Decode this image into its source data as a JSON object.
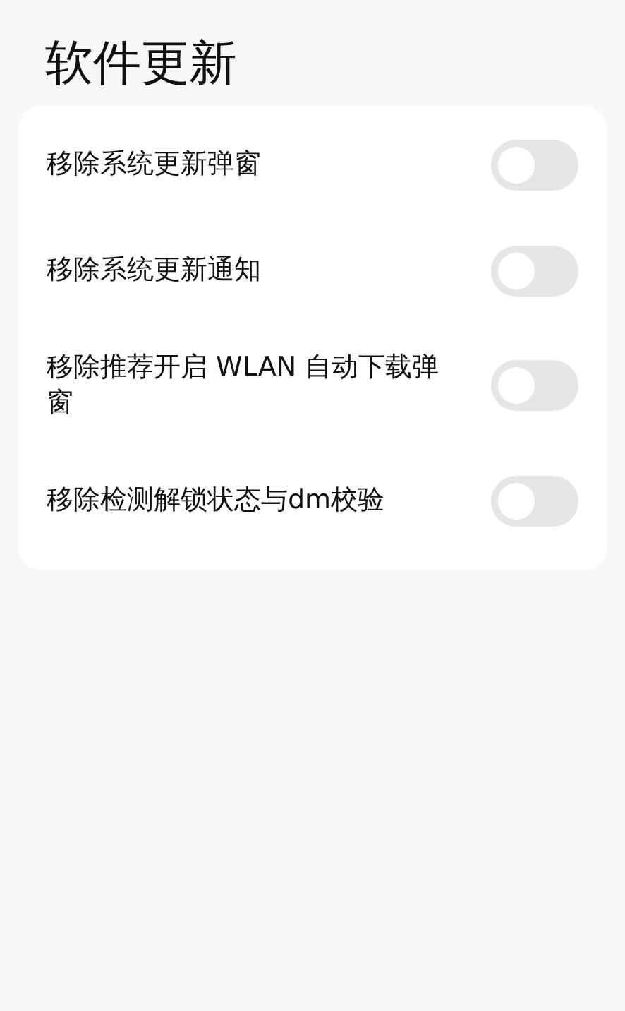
{
  "title": "软件更新",
  "settings": [
    {
      "label": "移除系统更新弹窗",
      "on": false
    },
    {
      "label": "移除系统更新通知",
      "on": false
    },
    {
      "label": "移除推荐开启 WLAN 自动下载弹窗",
      "on": false
    },
    {
      "label": "移除检测解锁状态与dm校验",
      "on": false
    }
  ]
}
